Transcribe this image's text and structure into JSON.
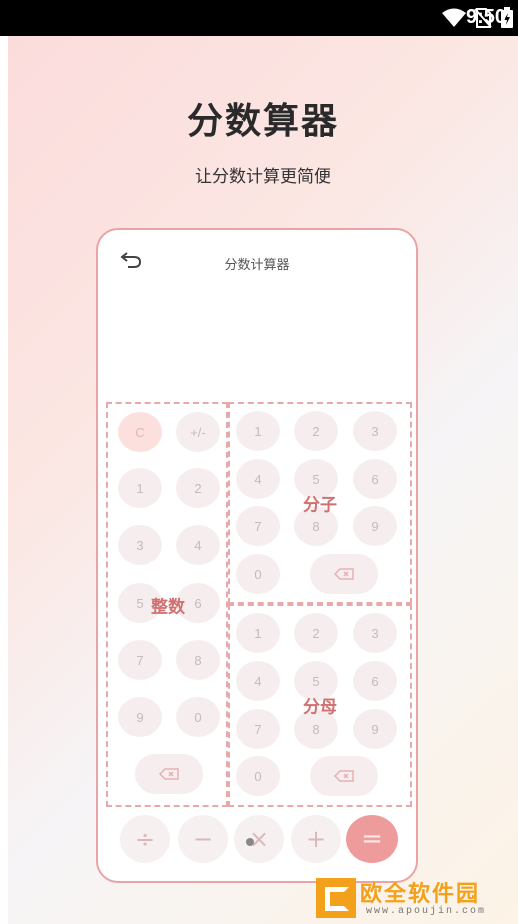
{
  "status": {
    "time": "9:50"
  },
  "page": {
    "title": "分数算器",
    "subtitle": "让分数计算更简便"
  },
  "phone": {
    "title": "分数计算器",
    "integer_zone": {
      "label": "整数",
      "keys": [
        "C",
        "+/-",
        "1",
        "2",
        "3",
        "4",
        "5",
        "6",
        "7",
        "8",
        "9",
        "0"
      ]
    },
    "numerator_zone": {
      "label": "分子",
      "keys": [
        "1",
        "2",
        "3",
        "4",
        "5",
        "6",
        "7",
        "8",
        "9",
        "0"
      ]
    },
    "denominator_zone": {
      "label": "分母",
      "keys": [
        "1",
        "2",
        "3",
        "4",
        "5",
        "6",
        "7",
        "8",
        "9",
        "0"
      ]
    },
    "operators": [
      "÷",
      "−",
      "×",
      "+",
      "="
    ]
  },
  "watermark": {
    "text": "欧全软件园",
    "url": "www.apoujin.com"
  }
}
